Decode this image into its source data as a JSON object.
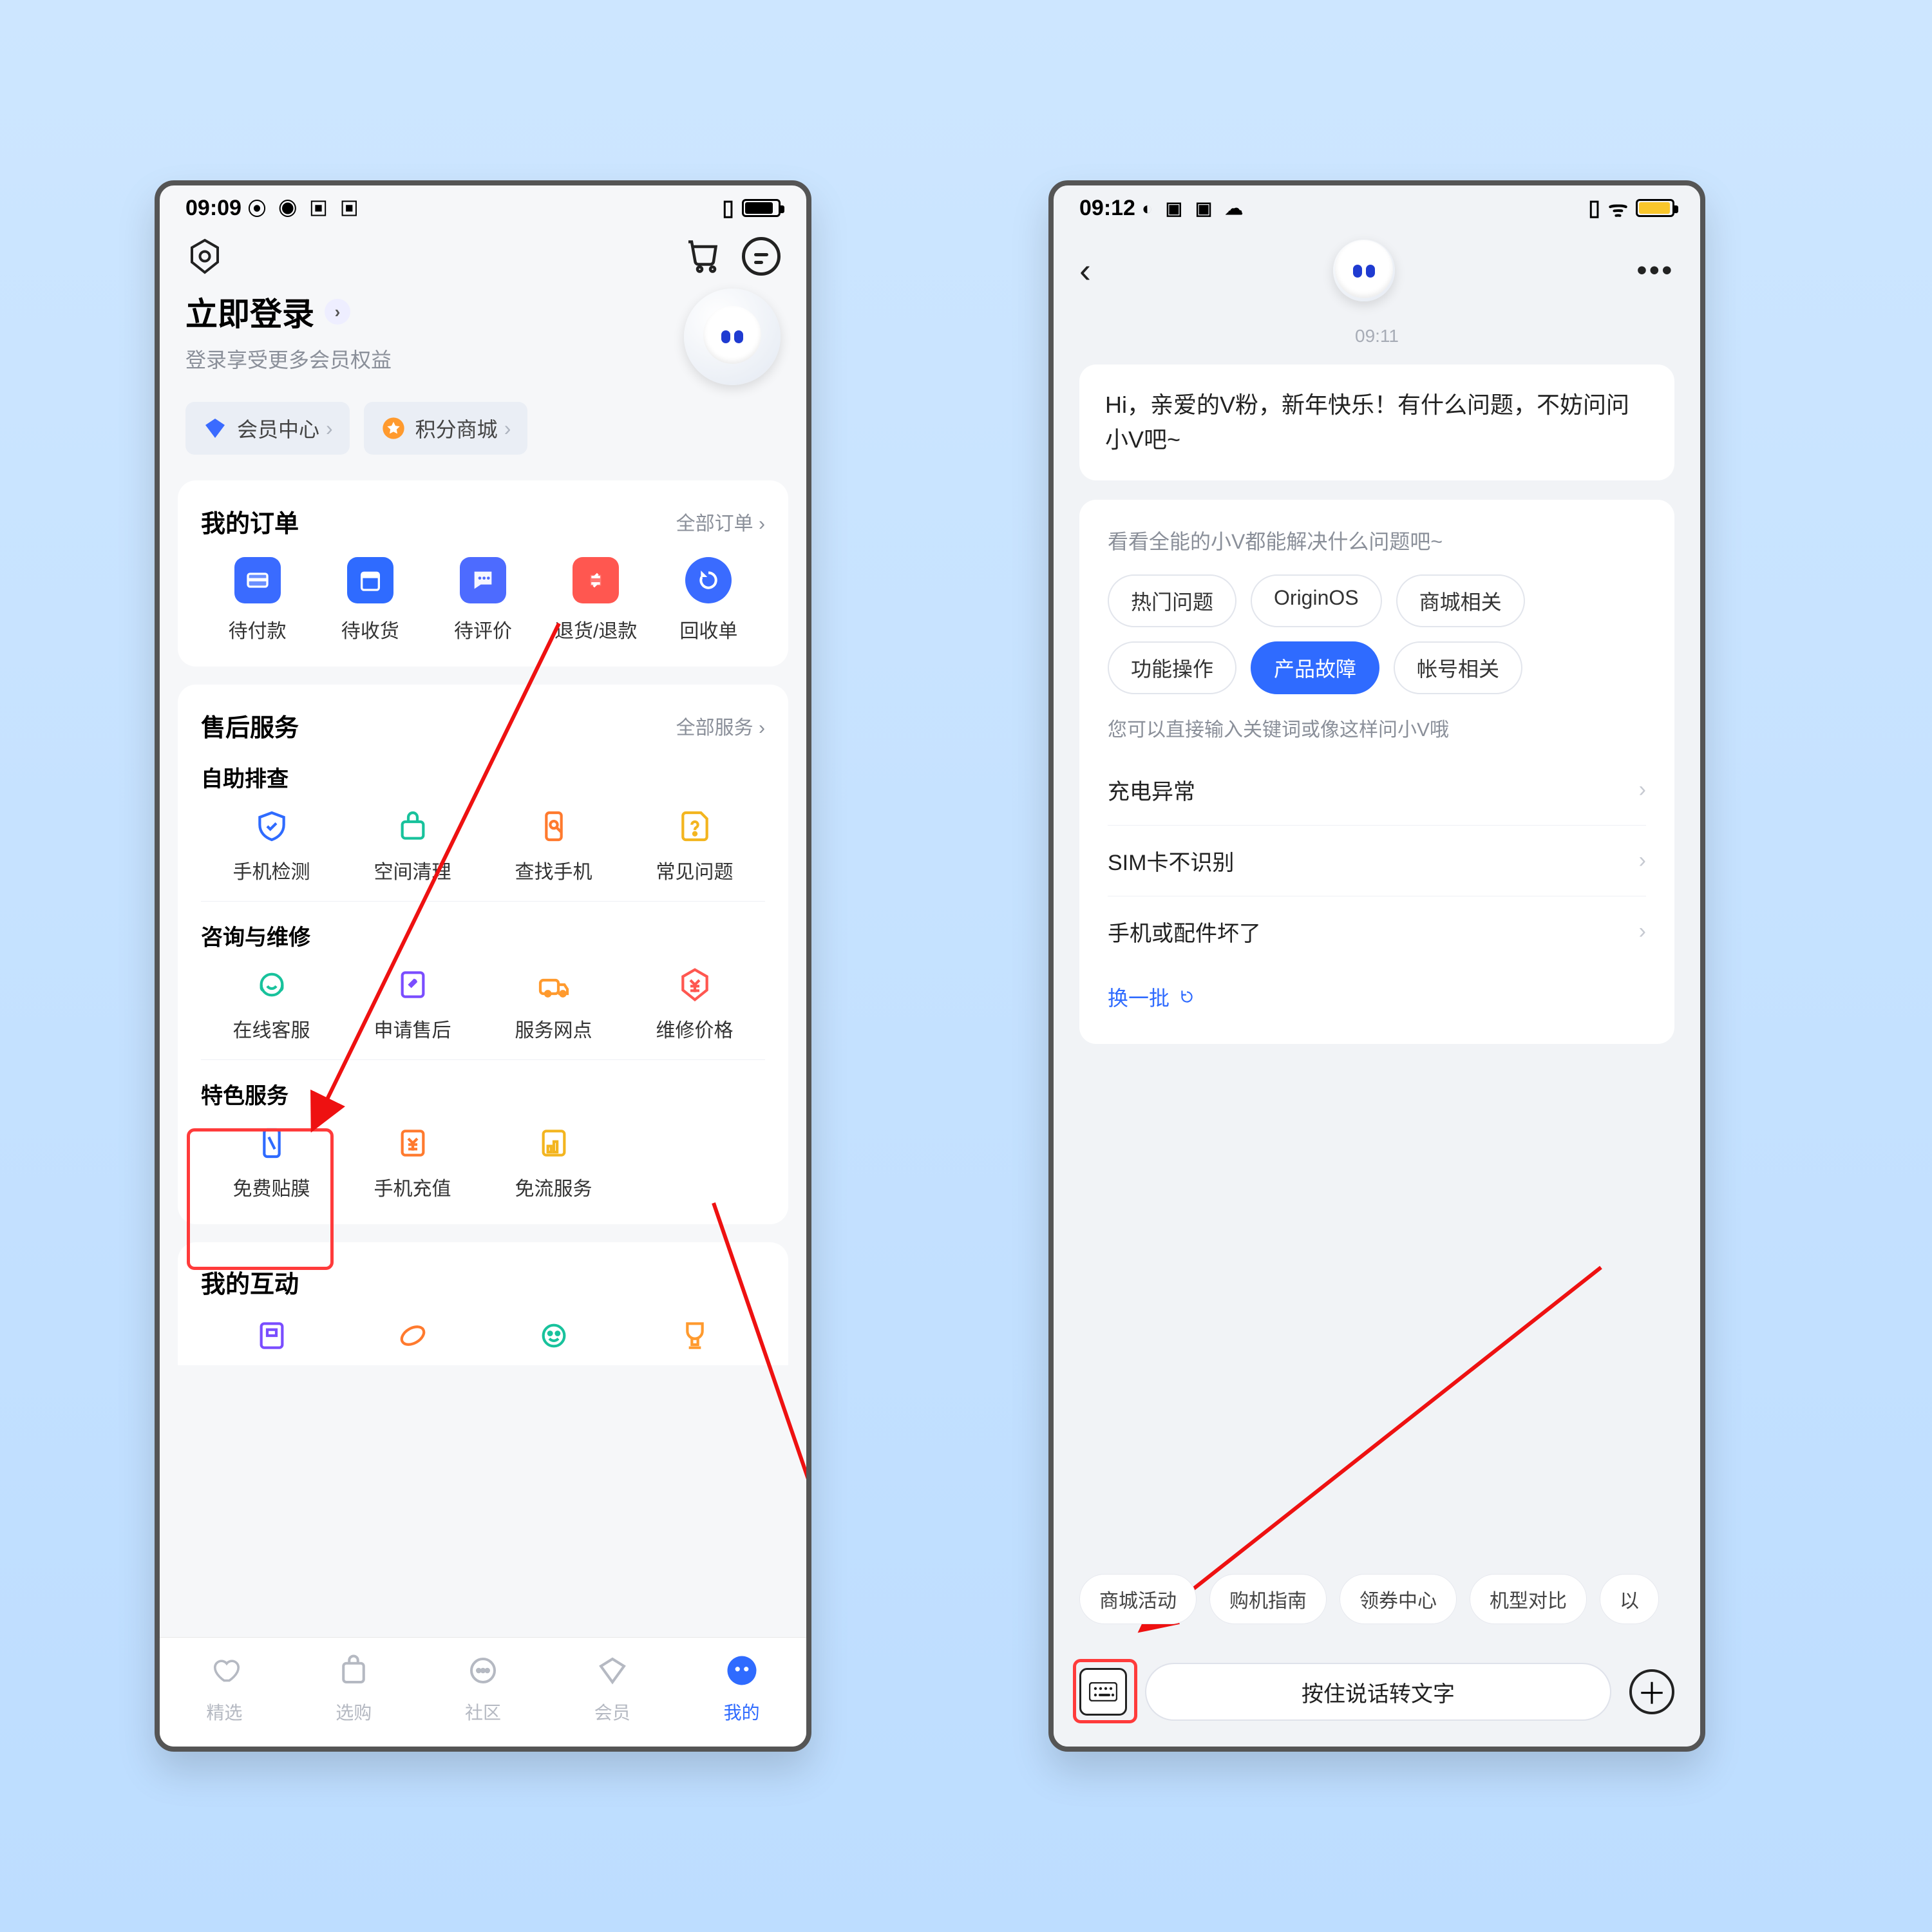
{
  "phone1": {
    "status": {
      "time": "09:09",
      "icons": "⦿ ◉ ▣ ▣"
    },
    "login": {
      "title": "立即登录",
      "subtitle": "登录享受更多会员权益"
    },
    "shortcuts": {
      "member": "会员中心",
      "points": "积分商城"
    },
    "orders": {
      "title": "我的订单",
      "more": "全部订单",
      "items": [
        "待付款",
        "待收货",
        "待评价",
        "退货/退款",
        "回收单"
      ]
    },
    "service": {
      "title": "售后服务",
      "more": "全部服务",
      "group1_title": "自助排查",
      "group1": [
        "手机检测",
        "空间清理",
        "查找手机",
        "常见问题"
      ],
      "group2_title": "咨询与维修",
      "group2": [
        "在线客服",
        "申请售后",
        "服务网点",
        "维修价格"
      ],
      "group3_title": "特色服务",
      "group3": [
        "免费贴膜",
        "手机充值",
        "免流服务"
      ]
    },
    "interact": {
      "title": "我的互动"
    },
    "tabs": [
      "精选",
      "选购",
      "社区",
      "会员",
      "我的"
    ]
  },
  "phone2": {
    "status": {
      "time": "09:12",
      "icons": "◐ ▣ ▣ ☁"
    },
    "timestamp": "09:11",
    "greeting": "Hi，亲爱的V粉，新年快乐！有什么问题，不妨问问小V吧~",
    "panel_title": "看看全能的小V都能解决什么问题吧~",
    "pills": [
      "热门问题",
      "OriginOS",
      "商城相关",
      "功能操作",
      "产品故障",
      "帐号相关"
    ],
    "active_pill": 4,
    "hint": "您可以直接输入关键词或像这样问小V哦",
    "questions": [
      "充电异常",
      "SIM卡不识别",
      "手机或配件坏了"
    ],
    "refresh": "换一批",
    "quick": [
      "商城活动",
      "购机指南",
      "领券中心",
      "机型对比",
      "以"
    ],
    "hold": "按住说话转文字"
  }
}
